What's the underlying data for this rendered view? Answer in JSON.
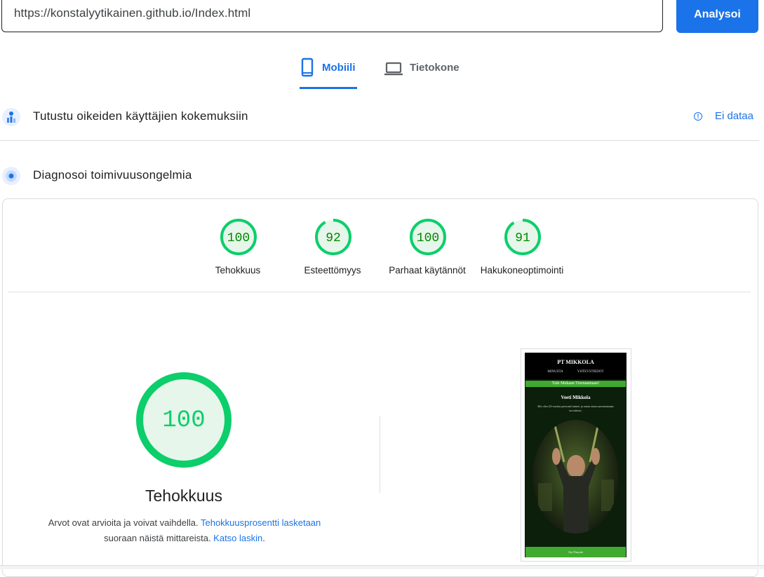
{
  "search": {
    "url": "https://konstalyytikainen.github.io/Index.html",
    "analyze_label": "Analysoi"
  },
  "tabs": [
    {
      "label": "Mobiili",
      "icon": "smartphone-icon",
      "selected": true
    },
    {
      "label": "Tietokone",
      "icon": "laptop-icon",
      "selected": false
    }
  ],
  "field_data": {
    "title": "Tutustu oikeiden käyttäjien kokemuksiin",
    "status": "Ei dataa",
    "icon": "people-chart-icon"
  },
  "lab_data": {
    "title": "Diagnosoi toimivuusongelmia",
    "icon": "diagnose-icon"
  },
  "scores": [
    {
      "value": "100",
      "label": "Tehokkuus",
      "fraction": 1.0
    },
    {
      "value": "92",
      "label": "Esteettömyys",
      "fraction": 0.92
    },
    {
      "value": "100",
      "label": "Parhaat käytännöt",
      "fraction": 1.0
    },
    {
      "value": "91",
      "label": "Hakukoneoptimointi",
      "fraction": 0.91
    }
  ],
  "performance": {
    "score": "100",
    "title": "Tehokkuus",
    "note_prefix": "Arvot ovat arvioita ja voivat vaihdella. ",
    "note_link1": "Tehokkuusprosentti lasketaan",
    "note_mid": " suoraan näistä mittareista. ",
    "note_link2": "Katso laskin",
    "note_suffix": "."
  },
  "screenshot": {
    "site_title": "PT MIKKOLA",
    "nav": [
      "MINUSTA",
      "YHTEYSTIEDOT"
    ],
    "banner": "Tule Mukaan Treenaamaan!",
    "person_name": "Veeti Mikkola",
    "description": "Hei olen 24-vuotias personal trainer ja autan sinua saavuttamaan tavoitteesi.",
    "footer": "Ota Yhteyttä"
  },
  "colors": {
    "accent": "#1a73e8",
    "pass": "#0cce6b",
    "pass_fill": "#e6f6ea",
    "pass_text": "#008800"
  }
}
